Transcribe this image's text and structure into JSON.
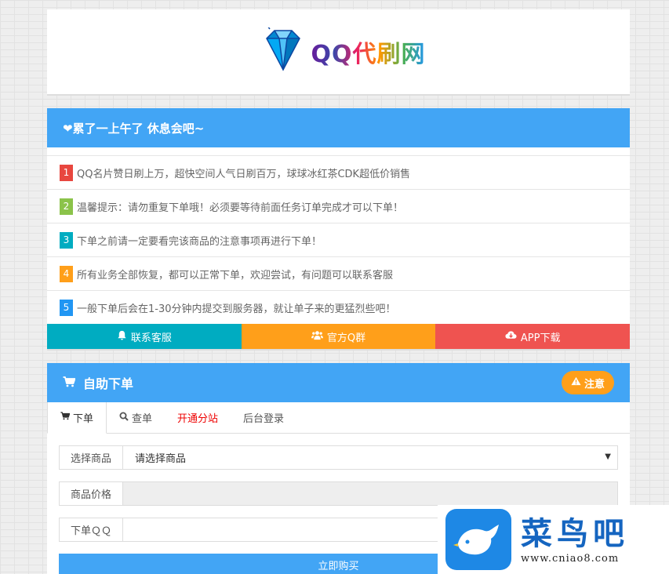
{
  "logo": {
    "text": "QQ代刷网",
    "icon": "diamond-icon"
  },
  "notice_panel": {
    "title": "❤累了一上午了 休息会吧~",
    "items": [
      {
        "num": "1",
        "text": "QQ名片赞日刷上万，超快空间人气日刷百万，球球冰红茶CDK超低价销售",
        "color": "#e8473f"
      },
      {
        "num": "2",
        "text": "温馨提示：请勿重复下单哦！必须要等待前面任务订单完成才可以下单！",
        "color": "#8bc34a"
      },
      {
        "num": "3",
        "text": "下单之前请一定要看完该商品的注意事项再进行下单！",
        "color": "#00acc1"
      },
      {
        "num": "4",
        "text": "所有业务全部恢复，都可以正常下单，欢迎尝试，有问题可以联系客服",
        "color": "#ff9f1a"
      },
      {
        "num": "5",
        "text": "一般下单后会在1-30分钟内提交到服务器，就让单子来的更猛烈些吧！",
        "color": "#2196f3"
      }
    ],
    "buttons": [
      {
        "label": "联系客服",
        "icon": "bell-icon",
        "color": "#00acc1"
      },
      {
        "label": "官方Q群",
        "icon": "users-icon",
        "color": "#ff9f1a"
      },
      {
        "label": "APP下载",
        "icon": "cloud-download-icon",
        "color": "#ef5350"
      }
    ]
  },
  "order_panel": {
    "title": "自助下单",
    "notice_button": "注意",
    "tabs": [
      {
        "label": "下单",
        "icon": "cart-icon"
      },
      {
        "label": "查单",
        "icon": "search-icon"
      },
      {
        "label": "开通分站",
        "icon": ""
      },
      {
        "label": "后台登录",
        "icon": ""
      }
    ],
    "form": {
      "product_label": "选择商品",
      "product_value": "请选择商品",
      "price_label": "商品价格",
      "price_value": "",
      "qq_label": "下单ＱＱ",
      "qq_value": "",
      "buy_label": "立即购买"
    }
  },
  "watermark": {
    "name": "菜鸟吧",
    "url": "www.cniao8.com"
  },
  "colors": {
    "primary": "#42a5f5",
    "orange": "#ff9f1a",
    "teal": "#00acc1",
    "red": "#ef5350"
  }
}
